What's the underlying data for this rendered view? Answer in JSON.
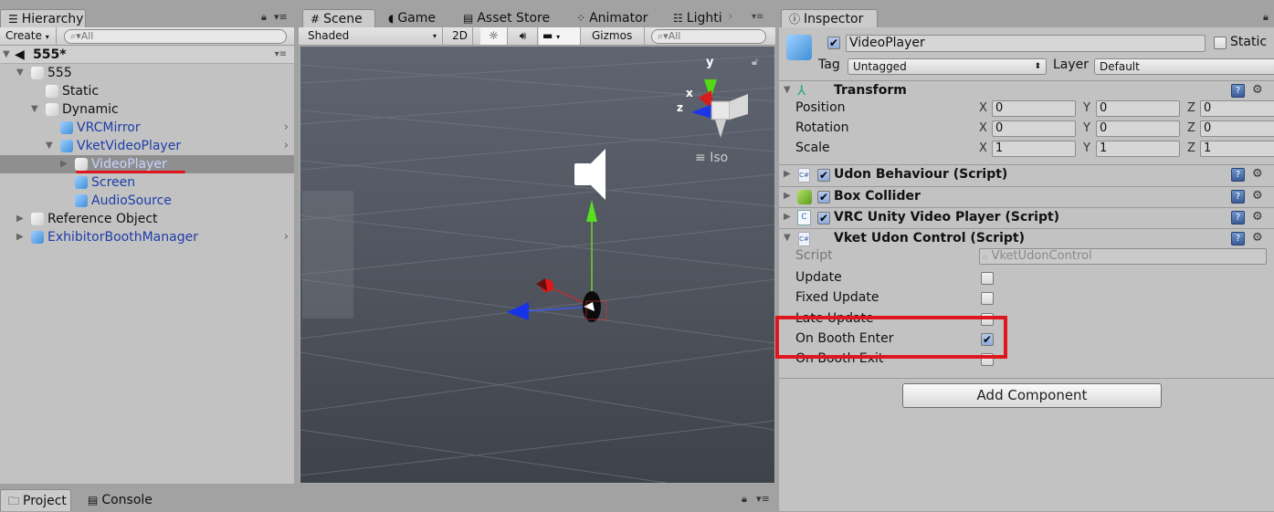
{
  "hierarchy": {
    "tab_label": "Hierarchy",
    "create_label": "Create",
    "search_placeholder": "All",
    "scene_name": "555*",
    "items": [
      {
        "label": "555",
        "depth": 1,
        "expanded": true,
        "prefab": false
      },
      {
        "label": "Static",
        "depth": 2,
        "expanded": null,
        "prefab": false
      },
      {
        "label": "Dynamic",
        "depth": 2,
        "expanded": true,
        "prefab": false
      },
      {
        "label": "VRCMirror",
        "depth": 3,
        "expanded": null,
        "prefab": true
      },
      {
        "label": "VketVideoPlayer",
        "depth": 3,
        "expanded": true,
        "prefab": true
      },
      {
        "label": "VideoPlayer",
        "depth": 4,
        "expanded": false,
        "prefab": true,
        "selected": true
      },
      {
        "label": "Screen",
        "depth": 4,
        "expanded": null,
        "prefab": true
      },
      {
        "label": "AudioSource",
        "depth": 4,
        "expanded": null,
        "prefab": true
      },
      {
        "label": "Reference Object",
        "depth": 1,
        "expanded": false,
        "prefab": false
      },
      {
        "label": "ExhibitorBoothManager",
        "depth": 1,
        "expanded": false,
        "prefab": true
      }
    ]
  },
  "scene": {
    "tabs": [
      {
        "label": "Scene",
        "icon": "grid-icon",
        "active": true
      },
      {
        "label": "Game",
        "icon": "pacman-icon"
      },
      {
        "label": "Asset Store",
        "icon": "store-icon"
      },
      {
        "label": "Animator",
        "icon": "animator-icon"
      },
      {
        "label": "Lighti",
        "icon": "sliders-icon"
      }
    ],
    "shading_mode": "Shaded",
    "mode_2d": "2D",
    "gizmos_label": "Gizmos",
    "search_placeholder": "All",
    "projection_label": "Iso",
    "axis_labels": {
      "x": "x",
      "y": "y",
      "z": "z"
    }
  },
  "inspector": {
    "tab_label": "Inspector",
    "object_name": "VideoPlayer",
    "active": true,
    "static_label": "Static",
    "static_checked": false,
    "tag_label": "Tag",
    "tag_value": "Untagged",
    "layer_label": "Layer",
    "layer_value": "Default",
    "transform": {
      "title": "Transform",
      "rows": [
        {
          "label": "Position",
          "x": "0",
          "y": "0",
          "z": "0"
        },
        {
          "label": "Rotation",
          "x": "0",
          "y": "0",
          "z": "0"
        },
        {
          "label": "Scale",
          "x": "1",
          "y": "1",
          "z": "1"
        }
      ]
    },
    "components": [
      {
        "title": "Udon Behaviour (Script)",
        "enabled": true,
        "icon": "script-icon"
      },
      {
        "title": "Box Collider",
        "enabled": true,
        "icon": "box-collider-icon"
      },
      {
        "title": "VRC Unity Video Player (Script)",
        "enabled": true,
        "icon": "csharp-icon"
      }
    ],
    "vket_control": {
      "title": "Vket Udon Control (Script)",
      "script_label": "Script",
      "script_value": "VketUdonControl",
      "props": [
        {
          "label": "Update",
          "checked": false
        },
        {
          "label": "Fixed Update",
          "checked": false
        },
        {
          "label": "Late Update",
          "checked": false
        },
        {
          "label": "On Booth Enter",
          "checked": true
        },
        {
          "label": "On Booth Exit",
          "checked": false
        }
      ]
    },
    "add_component_label": "Add Component",
    "axis": {
      "x": "X",
      "y": "Y",
      "z": "Z"
    }
  },
  "bottom": {
    "tabs": [
      {
        "label": "Project",
        "active": true
      },
      {
        "label": "Console"
      }
    ]
  },
  "annotations": {
    "highlight_color": "#e0161e"
  }
}
